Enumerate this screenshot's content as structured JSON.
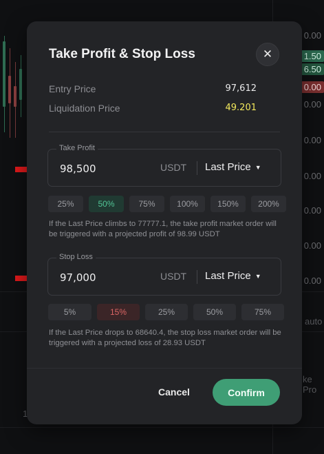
{
  "background": {
    "axis_labels": [
      "0.00",
      "0.00",
      "0.00",
      "0.00",
      "0.00",
      "0.00",
      "0.00",
      "0.00",
      "0.00"
    ],
    "tags": [
      "1.50",
      "6.50",
      "0.00"
    ],
    "misc": [
      "auto",
      "ke Pro",
      "1"
    ]
  },
  "modal": {
    "title": "Take Profit & Stop Loss",
    "close_icon": "close-icon",
    "entry_price_label": "Entry Price",
    "entry_price_value": "97,612",
    "liquidation_price_label": "Liquidation Price",
    "liquidation_price_value": "49.201",
    "take_profit": {
      "legend": "Take Profit",
      "value": "98,500",
      "unit": "USDT",
      "trigger_type": "Last Price",
      "chips": [
        "25%",
        "50%",
        "75%",
        "100%",
        "150%",
        "200%"
      ],
      "selected_chip": "50%",
      "hint": "If the Last Price climbs to 77777.1, the take profit market order will be triggered with a projected profit of 98.99 USDT"
    },
    "stop_loss": {
      "legend": "Stop Loss",
      "value": "97,000",
      "unit": "USDT",
      "trigger_type": "Last Price",
      "chips": [
        "5%",
        "15%",
        "25%",
        "50%",
        "75%"
      ],
      "selected_chip": "15%",
      "hint": "If the Last Price drops to 68640.4, the stop loss market order will be triggered with a projected loss of 28.93 USDT"
    },
    "cancel_label": "Cancel",
    "confirm_label": "Confirm"
  },
  "colors": {
    "accent_green": "#3f9e75",
    "liquidation_yellow": "#f2e85c",
    "stop_red": "#dc6565",
    "arrow_red": "#e0191b"
  }
}
